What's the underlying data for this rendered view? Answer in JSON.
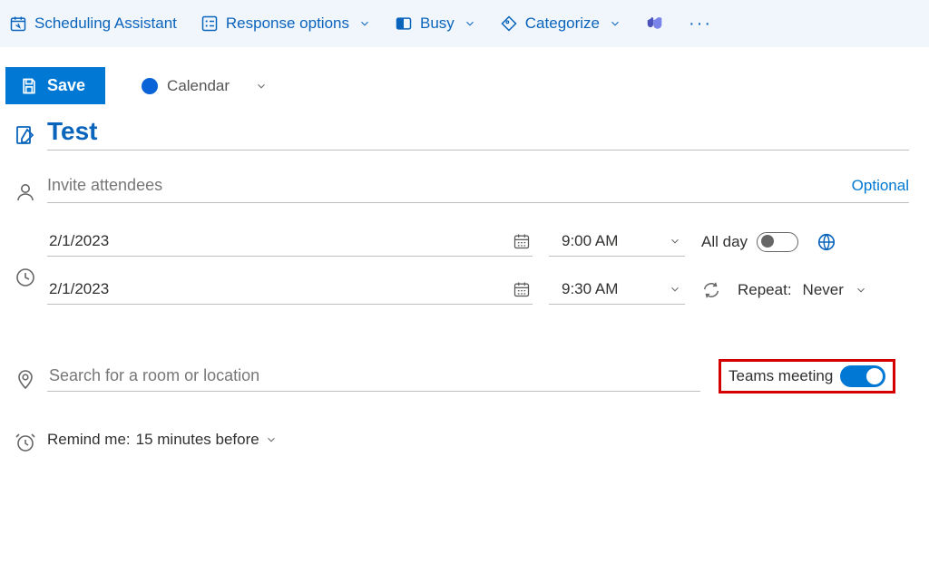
{
  "toolbar": {
    "scheduling": "Scheduling Assistant",
    "response": "Response options",
    "busy": "Busy",
    "categorize": "Categorize"
  },
  "actions": {
    "save": "Save",
    "calendar": "Calendar"
  },
  "event": {
    "title": "Test",
    "attendees_placeholder": "Invite attendees",
    "optional": "Optional",
    "start_date": "2/1/2023",
    "start_time": "9:00 AM",
    "end_date": "2/1/2023",
    "end_time": "9:30 AM",
    "all_day": "All day",
    "repeat_label": "Repeat:",
    "repeat_value": "Never",
    "location_placeholder": "Search for a room or location",
    "teams_meeting": "Teams meeting",
    "remind_label": "Remind me:",
    "remind_value": "15 minutes before"
  }
}
